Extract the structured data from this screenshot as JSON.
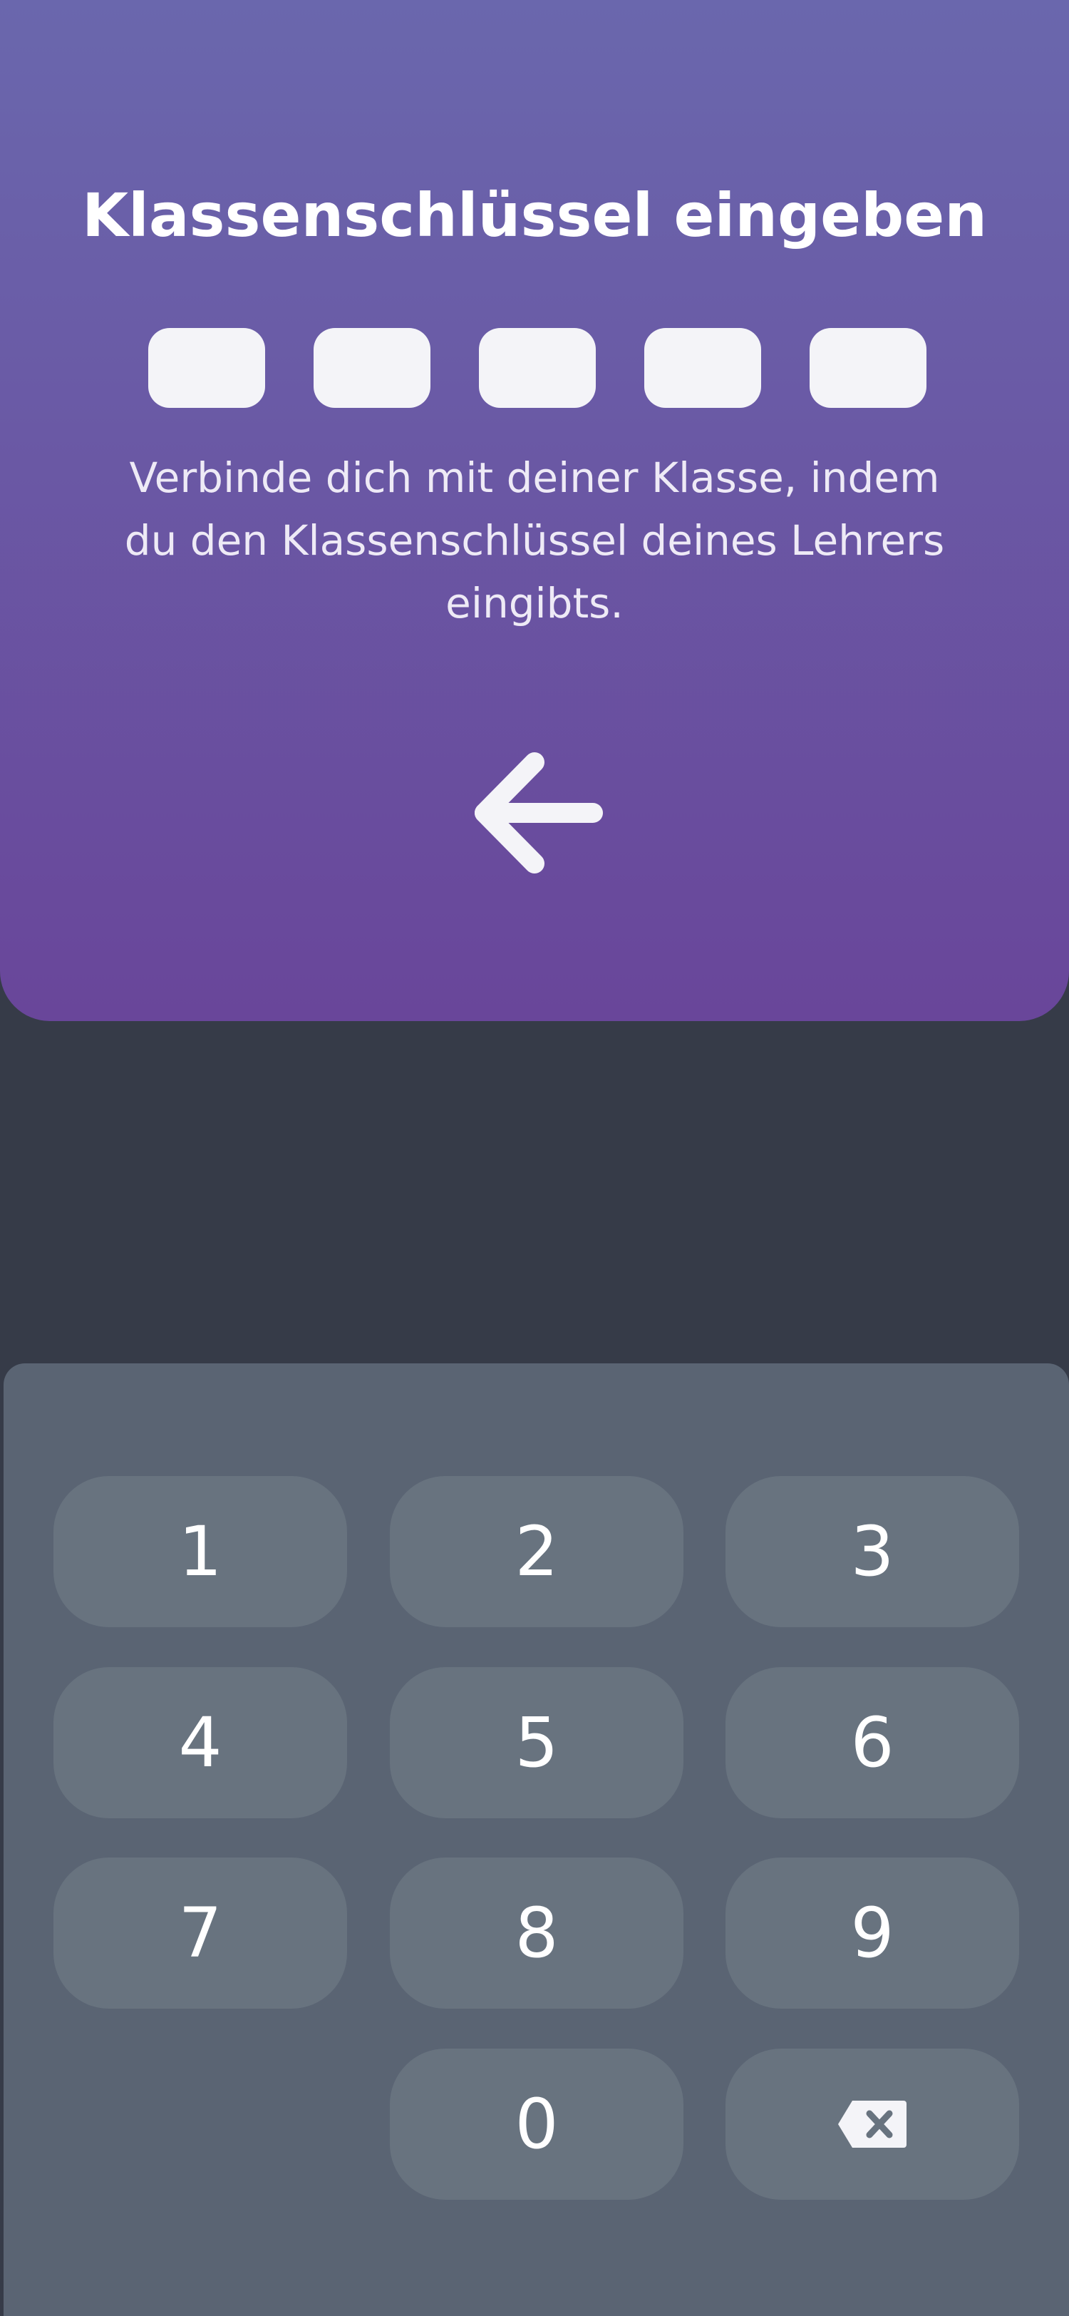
{
  "header": {
    "title": "Klassenschlüssel eingeben",
    "description": "Verbinde dich mit deiner Klasse, indem du den Klassenschlüssel deines Lehrers eingibts.",
    "code_length": 5,
    "back_icon": "arrow-left-icon"
  },
  "keypad": {
    "keys": [
      "1",
      "2",
      "3",
      "4",
      "5",
      "6",
      "7",
      "8",
      "9",
      "0"
    ],
    "backspace_icon": "backspace-icon"
  },
  "colors": {
    "header_gradient_top": "#6a67ad",
    "header_gradient_bottom": "#69469a",
    "background": "#363b48",
    "keypad_background": "#5a6473",
    "key_background": "#68737f",
    "code_box": "#f4f4f8"
  }
}
